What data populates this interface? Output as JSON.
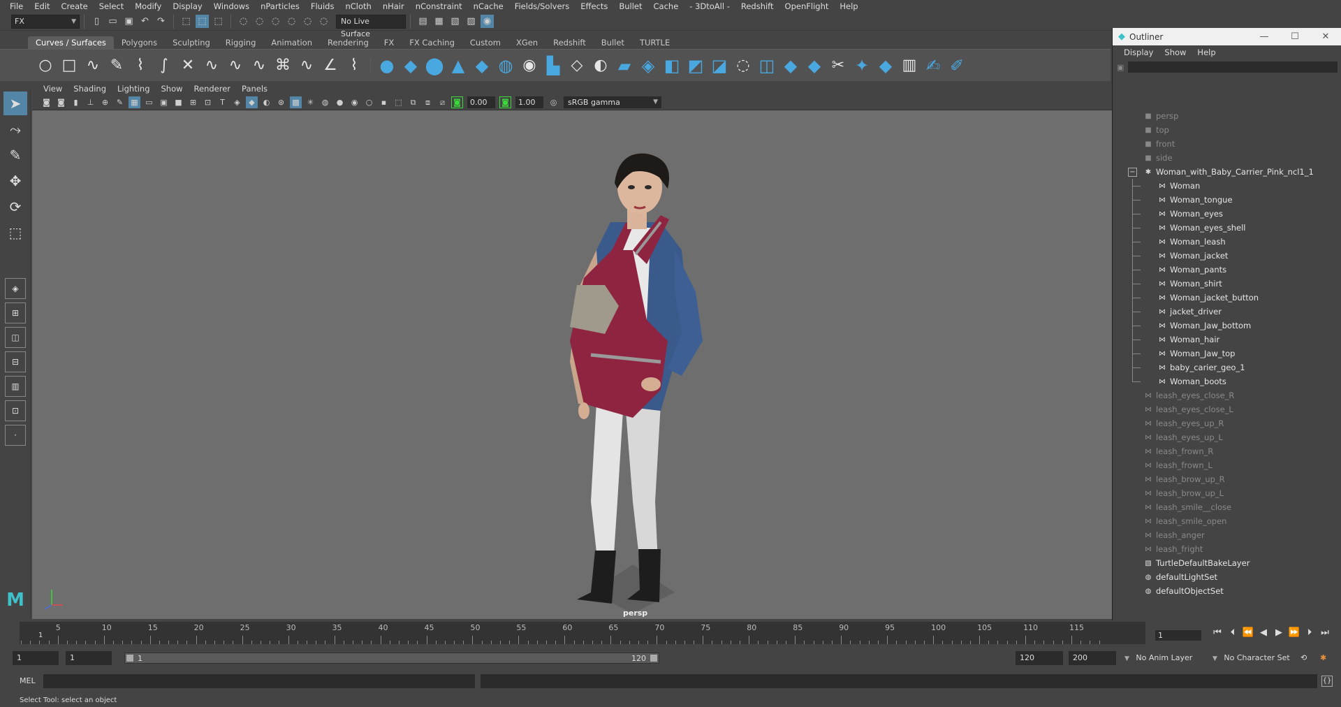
{
  "menubar": {
    "items": [
      "File",
      "Edit",
      "Create",
      "Select",
      "Modify",
      "Display",
      "Windows",
      "nParticles",
      "Fluids",
      "nCloth",
      "nHair",
      "nConstraint",
      "nCache",
      "Fields/Solvers",
      "Effects",
      "Bullet",
      "Cache",
      "- 3DtoAll -",
      "Redshift",
      "OpenFlight",
      "Help"
    ]
  },
  "statusline": {
    "mode": "FX",
    "live_surface": "No Live Surface"
  },
  "shelf": {
    "tabs": [
      "Curves / Surfaces",
      "Polygons",
      "Sculpting",
      "Rigging",
      "Animation",
      "Rendering",
      "FX",
      "FX Caching",
      "Custom",
      "XGen",
      "Redshift",
      "Bullet",
      "TURTLE"
    ],
    "active_tab": "Curves / Surfaces"
  },
  "panel": {
    "menus": [
      "View",
      "Shading",
      "Lighting",
      "Show",
      "Renderer",
      "Panels"
    ],
    "exposure": "0.00",
    "gamma_value": "1.00",
    "color_space": "sRGB gamma",
    "camera_label": "persp"
  },
  "outliner": {
    "title": "Outliner",
    "menus": [
      "Display",
      "Show",
      "Help"
    ],
    "cameras": [
      "persp",
      "top",
      "front",
      "side"
    ],
    "group": "Woman_with_Baby_Carrier_Pink_ncl1_1",
    "children": [
      "Woman",
      "Woman_tongue",
      "Woman_eyes",
      "Woman_eyes_shell",
      "Woman_leash",
      "Woman_jacket",
      "Woman_pants",
      "Woman_shirt",
      "Woman_jacket_button",
      "jacket_driver",
      "Woman_Jaw_bottom",
      "Woman_hair",
      "Woman_Jaw_top",
      "baby_carier_geo_1",
      "Woman_boots"
    ],
    "leashes": [
      "leash_eyes_close_R",
      "leash_eyes_close_L",
      "leash_eyes_up_R",
      "leash_eyes_up_L",
      "leash_frown_R",
      "leash_frown_L",
      "leash_brow_up_R",
      "leash_brow_up_L",
      "leash_smile__close",
      "leash_smile_open",
      "leash_anger",
      "leash_fright"
    ],
    "sets": [
      "TurtleDefaultBakeLayer",
      "defaultLightSet",
      "defaultObjectSet"
    ]
  },
  "timeline": {
    "ticks": [
      5,
      10,
      15,
      20,
      25,
      30,
      35,
      40,
      45,
      50,
      55,
      60,
      65,
      70,
      75,
      80,
      85,
      90,
      95,
      100,
      105,
      110,
      115
    ],
    "current_frame": "1",
    "current_frame_field": "1"
  },
  "range": {
    "start": "1",
    "playback_start": "1",
    "slider_start": "1",
    "slider_end": "120",
    "playback_end": "120",
    "end": "200",
    "anim_layer": "No Anim Layer",
    "character_set": "No Character Set"
  },
  "cmdline": {
    "label": "MEL"
  },
  "help": {
    "text": "Select Tool: select an object"
  }
}
